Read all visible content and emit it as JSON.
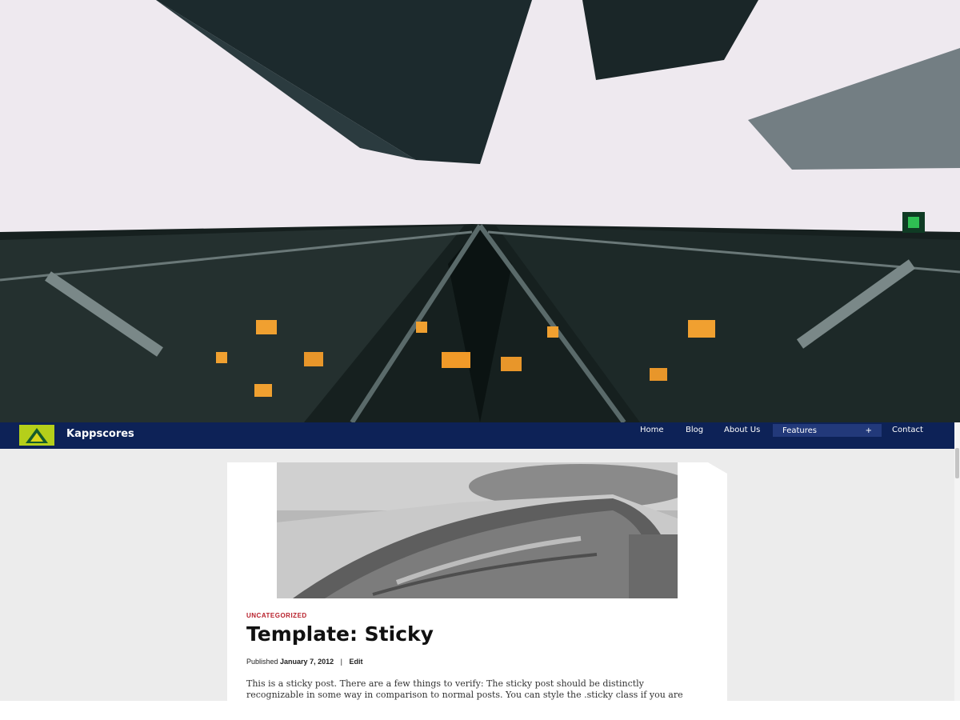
{
  "site": {
    "title": "Kappscores"
  },
  "nav": {
    "home": "Home",
    "blog": "Blog",
    "about": "About Us",
    "features": "Features",
    "features_expand": "+",
    "contact": "Contact"
  },
  "post": {
    "category": "UNCATEGORIZED",
    "title": "Template: Sticky",
    "published_label": "Published",
    "date": "January 7, 2012",
    "separator": "|",
    "edit": "Edit",
    "excerpt": "This is a sticky post. There are a few things to verify: The sticky post should be distinctly recognizable in some way in comparison to normal posts. You can style the .sticky class if you are using the post_class() function to generate your post classes, which is a best practice. They should show at the"
  },
  "colors": {
    "navbar": "#0d2257",
    "features_highlight": "#22397a",
    "logo": "#b5cf1a",
    "category": "#b8202b",
    "page_background": "#ececec"
  },
  "icons": {
    "logo": "triangle-logo-icon"
  }
}
